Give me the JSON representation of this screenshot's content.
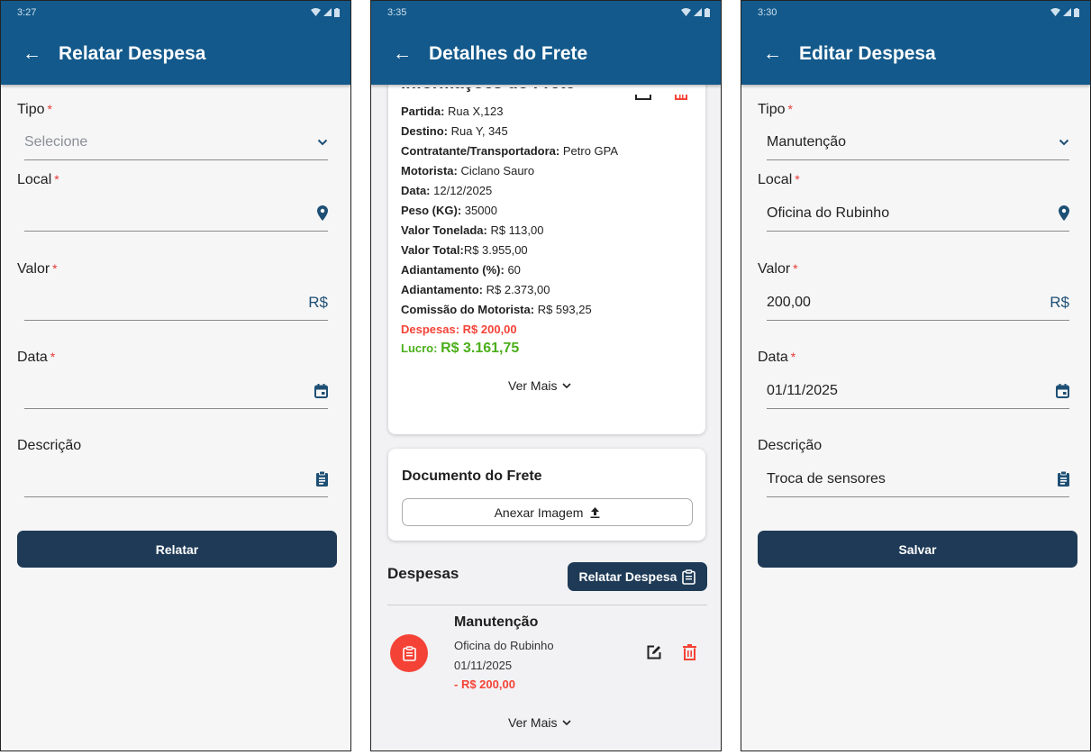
{
  "screen1": {
    "status_time": "3:27",
    "title": "Relatar Despesa",
    "tipo_label": "Tipo",
    "tipo_placeholder": "Selecione",
    "local_label": "Local",
    "valor_label": "Valor",
    "valor_suffix": "R$",
    "data_label": "Data",
    "descricao_label": "Descrição",
    "submit_label": "Relatar"
  },
  "screen2": {
    "status_time": "3:35",
    "title": "Detalhes do Frete",
    "card_title": "Informações do Frete",
    "lines": [
      {
        "key": "Partida:",
        "value": " Rua X,123"
      },
      {
        "key": "Destino:",
        "value": " Rua Y, 345"
      },
      {
        "key": "Contratante/Transportadora:",
        "value": " Petro GPA"
      },
      {
        "key": "Motorista:",
        "value": " Ciclano Sauro"
      },
      {
        "key": "Data:",
        "value": " 12/12/2025"
      },
      {
        "key": "Peso (KG):",
        "value": " 35000"
      },
      {
        "key": "Valor Tonelada:",
        "value": " R$ 113,00"
      },
      {
        "key": "Valor Total:",
        "value": "R$ 3.955,00"
      },
      {
        "key": "Adiantamento (%):",
        "value": " 60"
      },
      {
        "key": "Adiantamento:",
        "value": " R$ 2.373,00"
      },
      {
        "key": "Comissão do Motorista:",
        "value": " R$ 593,25"
      }
    ],
    "despesas_line": "Despesas: R$ 200,00",
    "lucro_label": "Lucro:",
    "lucro_value": "R$ 3.161,75",
    "ver_mais": "Ver Mais",
    "doc_title": "Documento do Frete",
    "attach_label": "Anexar Imagem",
    "despesas_title": "Despesas",
    "relatar_button": "Relatar Despesa",
    "expense": {
      "tipo": "Manutenção",
      "local": "Oficina do Rubinho",
      "data": "01/11/2025",
      "valor": "- R$ 200,00"
    },
    "ver_mais_2": "Ver Mais"
  },
  "screen3": {
    "status_time": "3:30",
    "title": "Editar Despesa",
    "tipo_label": "Tipo",
    "tipo_value": "Manutenção",
    "local_label": "Local",
    "local_value": "Oficina do Rubinho",
    "valor_label": "Valor",
    "valor_value": "200,00",
    "valor_suffix": "R$",
    "data_label": "Data",
    "data_value": "01/11/2025",
    "descricao_label": "Descrição",
    "descricao_value": "Troca de sensores",
    "submit_label": "Salvar"
  },
  "colors": {
    "appbar": "#13598b",
    "button": "#1e3a56",
    "required": "#e53935",
    "expense_red": "#f44336",
    "profit_green": "#4caf1a",
    "icon_blue": "#1e4f74"
  }
}
